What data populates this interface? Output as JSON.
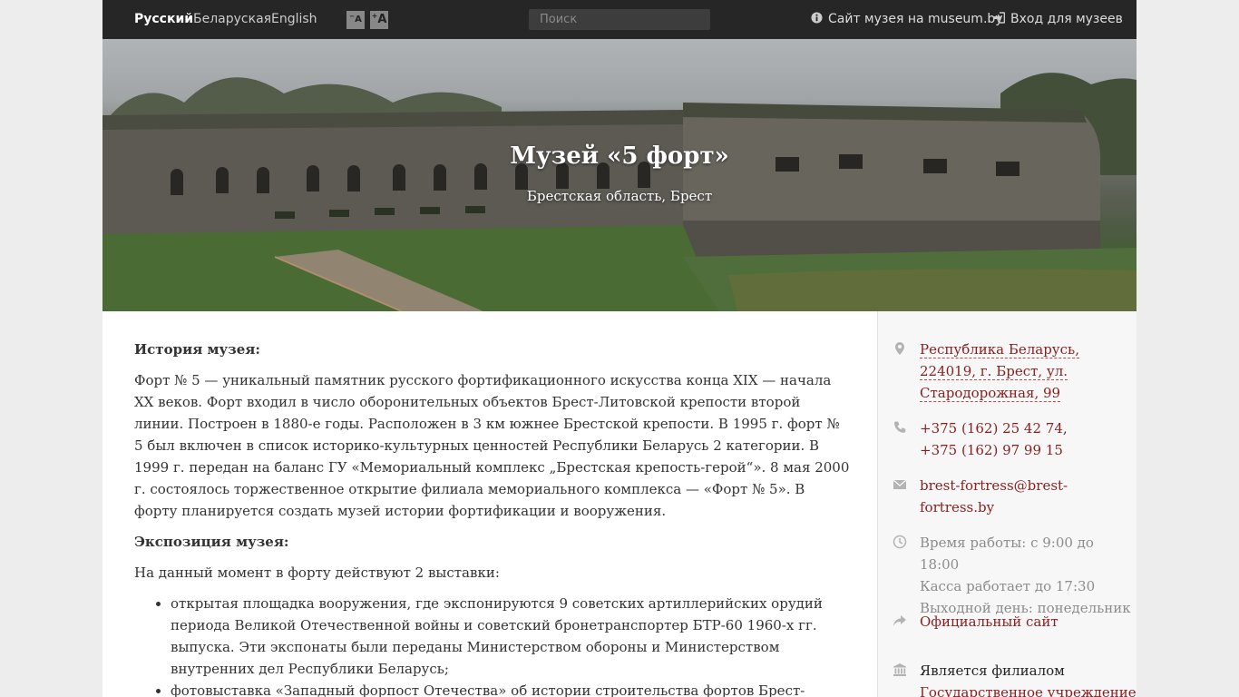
{
  "topbar": {
    "languages": [
      {
        "label": "Русский",
        "active": true
      },
      {
        "label": "Беларуская",
        "active": false
      },
      {
        "label": "English",
        "active": false
      }
    ],
    "font_smaller": "A",
    "font_larger": "A",
    "search_placeholder": "Поиск",
    "museum_site_link": "Сайт музея на museum.by",
    "login_link": "Вход для музеев"
  },
  "hero": {
    "title": "Музей «5 форт»",
    "location": "Брестская область, Брест"
  },
  "main": {
    "history_heading": "История музея:",
    "history_text": "Форт № 5 — уникальный памятник русского фортификационного искусства конца XIX — начала XX веков. Форт входил в число оборонительных объектов Брест-Литовской крепости второй линии. Построен в 1880-е годы. Расположен в 3 км южнее Брестской крепости. В 1995 г. форт № 5 был включен в список историко-культурных ценностей Республики Беларусь 2 категории. В 1999 г. передан на баланс ГУ «Мемориальный комплекс „Брестская крепость-герой“». 8 мая 2000 г. состоялось торжественное открытие филиала мемориального комплекса — «Форт № 5». В форту планируется создать музей истории фортификации и вооружения.",
    "exposition_heading": "Экспозиция музея:",
    "exposition_intro": "На данный момент в форту действуют 2 выставки:",
    "exhibitions": [
      "открытая площадка вооружения, где экспонируются 9 советских артиллерийских орудий периода Великой Отечественной войны и советский бронетранспортер БТР-60 1960-х гг. выпуска. Эти экспонаты были переданы Министерством обороны и Министерством внутренних дел Республики Беларусь;",
      "фотовыставка «Западный форпост Отечества» об истории строительства фортов Брест-Литовской"
    ]
  },
  "sidebar": {
    "address": "Республика Беларусь, 224019, г. Брест, ул. Стародорожная, 99",
    "address_lines": [
      "Республика Беларусь,",
      "224019, г. Брест, ул.",
      "Стародорожная, 99"
    ],
    "phone1": "+375 (162) 25 42 74",
    "phone_sep": ",",
    "phone2": "+375 (162) 97 99 15",
    "email_lines": [
      "brest-fortress@brest-",
      "fortress.by"
    ],
    "hours_lines": [
      "Время работы: с 9:00 до 18:00",
      "Касса работает до 17:30",
      "Выходной день: понедельник"
    ],
    "official_site": "Официальный сайт",
    "branch_label": "Является филиалом",
    "branch_parent": "Государственное учреждение"
  },
  "colors": {
    "topbar_bg": "#262626",
    "link_red": "#8a1e1e",
    "sidebar_bg": "#f7f7f7"
  },
  "icons": {
    "address": "map-pin-icon",
    "phone": "phone-icon",
    "email": "envelope-icon",
    "hours": "clock-icon",
    "site": "share-arrow-icon",
    "branch": "institution-icon",
    "museum_site": "info-circle-icon",
    "login": "sign-in-icon"
  }
}
